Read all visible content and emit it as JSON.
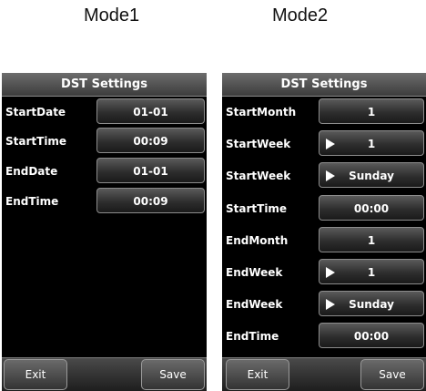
{
  "mode1": {
    "title": "Mode1",
    "header": "DST Settings",
    "rows": [
      {
        "label": "StartDate",
        "value": "01-01"
      },
      {
        "label": "StartTime",
        "value": "00:09"
      },
      {
        "label": "EndDate",
        "value": "01-01"
      },
      {
        "label": "EndTime",
        "value": "00:09"
      }
    ],
    "exit_label": "Exit",
    "save_label": "Save"
  },
  "mode2": {
    "title": "Mode2",
    "header": "DST Settings",
    "rows": [
      {
        "label": "StartMonth",
        "value": "1"
      },
      {
        "label": "StartWeek",
        "value": "1"
      },
      {
        "label": "StartWeek",
        "value": "Sunday"
      },
      {
        "label": "StartTime",
        "value": "00:00"
      },
      {
        "label": "EndMonth",
        "value": "1"
      },
      {
        "label": "EndWeek",
        "value": "1"
      },
      {
        "label": "EndWeek",
        "value": "Sunday"
      },
      {
        "label": "EndTime",
        "value": "00:00"
      }
    ],
    "exit_label": "Exit",
    "save_label": "Save"
  }
}
